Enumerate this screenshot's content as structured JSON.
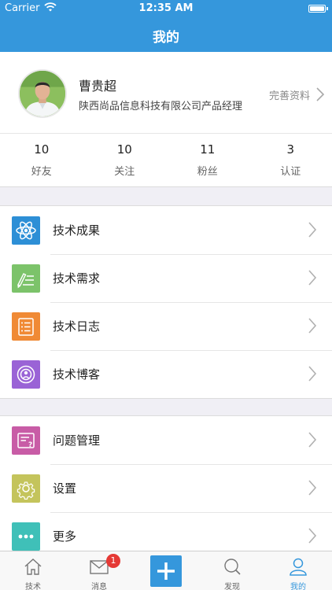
{
  "status_bar": {
    "carrier": "Carrier",
    "time": "12:35 AM"
  },
  "nav": {
    "title": "我的"
  },
  "profile": {
    "name": "曹贵超",
    "company": "陕西尚品信息科技有限公司产品经理",
    "edit_label": "完善资料"
  },
  "stats": [
    {
      "value": "10",
      "label": "好友"
    },
    {
      "value": "10",
      "label": "关注"
    },
    {
      "value": "11",
      "label": "粉丝"
    },
    {
      "value": "3",
      "label": "认证"
    }
  ],
  "menu_group_1": [
    {
      "label": "技术成果",
      "icon": "atom-icon",
      "color": "#2d8fd6"
    },
    {
      "label": "技术需求",
      "icon": "pen-list-icon",
      "color": "#7cc36a"
    },
    {
      "label": "技术日志",
      "icon": "list-doc-icon",
      "color": "#f08a35"
    },
    {
      "label": "技术博客",
      "icon": "podcast-user-icon",
      "color": "#9a63d6"
    }
  ],
  "menu_group_2": [
    {
      "label": "问题管理",
      "icon": "question-doc-icon",
      "color": "#c85ca6"
    },
    {
      "label": "设置",
      "icon": "gear-icon",
      "color": "#c4c45c"
    },
    {
      "label": "更多",
      "icon": "more-dots-icon",
      "color": "#3fc0b8"
    }
  ],
  "tabbar": {
    "tabs": [
      {
        "label": "技术",
        "icon": "home-icon"
      },
      {
        "label": "消息",
        "icon": "mail-icon",
        "badge": "1"
      },
      {
        "label": "",
        "icon": "plus-icon"
      },
      {
        "label": "发现",
        "icon": "search-icon"
      },
      {
        "label": "我的",
        "icon": "user-icon"
      }
    ],
    "active_color": "#3597dc"
  }
}
